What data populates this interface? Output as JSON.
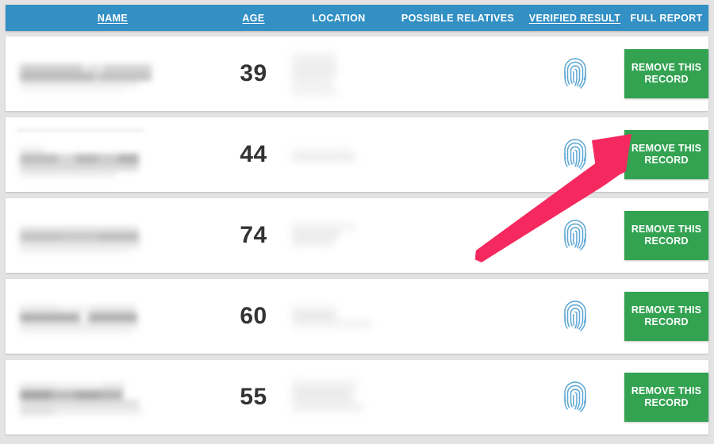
{
  "colors": {
    "header_bar": "#3390c4",
    "page_background": "#e3e3e3",
    "row_background": "#ffffff",
    "button_green": "#33a352",
    "fingerprint_blue": "#5ba6d4",
    "arrow_pink": "#f5295f",
    "age_text": "#333333"
  },
  "table": {
    "columns": [
      {
        "label": "NAME",
        "underlined": true
      },
      {
        "label": "AGE",
        "underlined": true
      },
      {
        "label": "LOCATION",
        "underlined": false
      },
      {
        "label": "POSSIBLE RELATIVES",
        "underlined": false
      },
      {
        "label": "VERIFIED RESULT",
        "underlined": true
      },
      {
        "label": "FULL REPORT",
        "underlined": false
      }
    ],
    "rows": [
      {
        "name": "",
        "name_redacted": true,
        "age": "39",
        "location": "",
        "location_redacted": true,
        "verified_icon": "fingerprint-icon",
        "action_label": "REMOVE THIS RECORD"
      },
      {
        "name": "",
        "name_redacted": true,
        "age": "44",
        "location": "",
        "location_redacted": true,
        "verified_icon": "fingerprint-icon",
        "action_label": "REMOVE THIS RECORD"
      },
      {
        "name": "",
        "name_redacted": true,
        "age": "74",
        "location": "",
        "location_redacted": true,
        "verified_icon": "fingerprint-icon",
        "action_label": "REMOVE THIS RECORD"
      },
      {
        "name": "",
        "name_redacted": true,
        "age": "60",
        "location": "",
        "location_redacted": true,
        "verified_icon": "fingerprint-icon",
        "action_label": "REMOVE THIS RECORD"
      },
      {
        "name": "",
        "name_redacted": true,
        "age": "55",
        "location": "",
        "location_redacted": true,
        "verified_icon": "fingerprint-icon",
        "action_label": "REMOVE THIS RECORD"
      }
    ]
  },
  "annotation": {
    "type": "arrow",
    "icon": "arrow-up-right-icon",
    "color": "#f5295f",
    "points_to": "REMOVE THIS RECORD",
    "target_row_index": 1
  }
}
